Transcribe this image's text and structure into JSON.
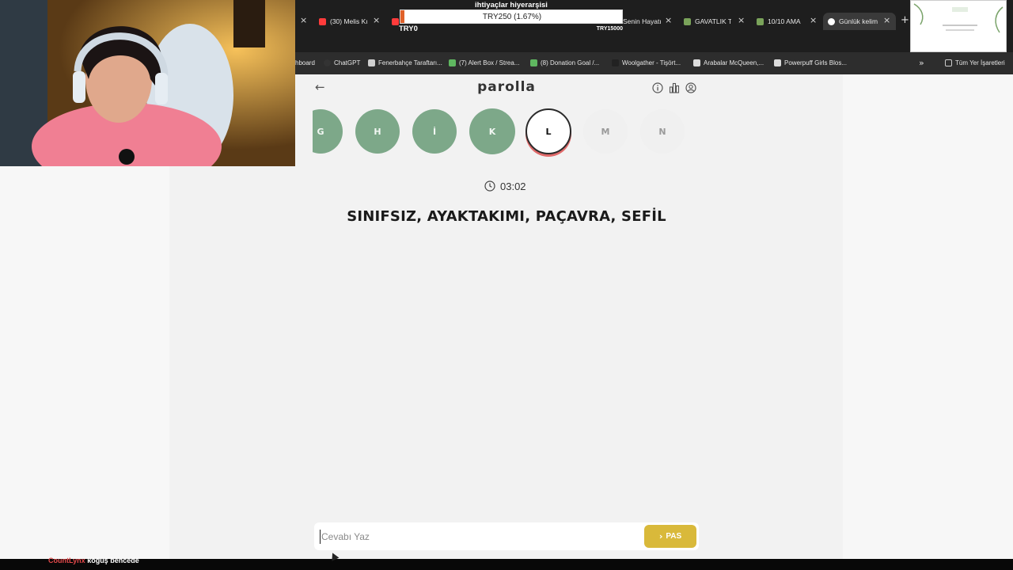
{
  "browser": {
    "tabs": [
      {
        "title": "(30) Melis Kı",
        "favicon_color": "#ff3b3b"
      },
      {
        "title": "",
        "favicon_color": "#ff3b3b"
      },
      {
        "title": "Senin Hayatı",
        "favicon_color": "#1e1e1e"
      },
      {
        "title": "GAVATLIK Tİ",
        "favicon_color": "#7aa35a"
      },
      {
        "title": "10/10 AMA",
        "favicon_color": "#7aa35a"
      },
      {
        "title": "Günlük kelim",
        "favicon_color": "#ffffff"
      }
    ],
    "bookmarks": [
      {
        "label": "hboard",
        "color": "#2d2d2d"
      },
      {
        "label": "ChatGPT",
        "color": "#333333"
      },
      {
        "label": "Fenerbahçe Taraftarı...",
        "color": "#cfcfcf"
      },
      {
        "label": "(7) Alert Box / Strea...",
        "color": "#5fb760"
      },
      {
        "label": "(8) Donation Goal /...",
        "color": "#5fb760"
      },
      {
        "label": "Woolgather - Tişört...",
        "color": "#222222"
      },
      {
        "label": "Arabalar McQueen,...",
        "color": "#dcdcdc"
      },
      {
        "label": "Powerpuff Girls Blos...",
        "color": "#dcdcdc"
      }
    ],
    "bookmarks_folder": "Tüm Yer İşaretleri"
  },
  "donation_goal": {
    "title": "ihtiyaçlar hiyerarşisi",
    "amount_text": "TRY250 (1.67%)",
    "progress": 0.0167,
    "min_label": "TRY0",
    "max_label": "TRY15000",
    "accent": "#e0612a"
  },
  "app": {
    "brand": "parolla",
    "back_icon": "arrow-left-icon",
    "icons": [
      "info-icon",
      "bar-chart-icon",
      "user-circle-icon"
    ]
  },
  "letters": [
    {
      "letter": "G",
      "state": "done"
    },
    {
      "letter": "H",
      "state": "done"
    },
    {
      "letter": "İ",
      "state": "done"
    },
    {
      "letter": "K",
      "state": "done"
    },
    {
      "letter": "L",
      "state": "current"
    },
    {
      "letter": "M",
      "state": "pending"
    },
    {
      "letter": "N",
      "state": "pending"
    }
  ],
  "colors": {
    "done": "#7da889",
    "current_ring": "#e06a6a",
    "pass_button": "#d9b93a"
  },
  "timer": "03:02",
  "clue": "SINIFSIZ, AYAKTAKIMI, PAÇAVRA, SEFİL",
  "answer": {
    "placeholder": "Cevabı Yaz",
    "value": "",
    "pass_label": "PAS"
  },
  "chat": {
    "user": "CountLynx",
    "message": "koğuş bencede"
  }
}
